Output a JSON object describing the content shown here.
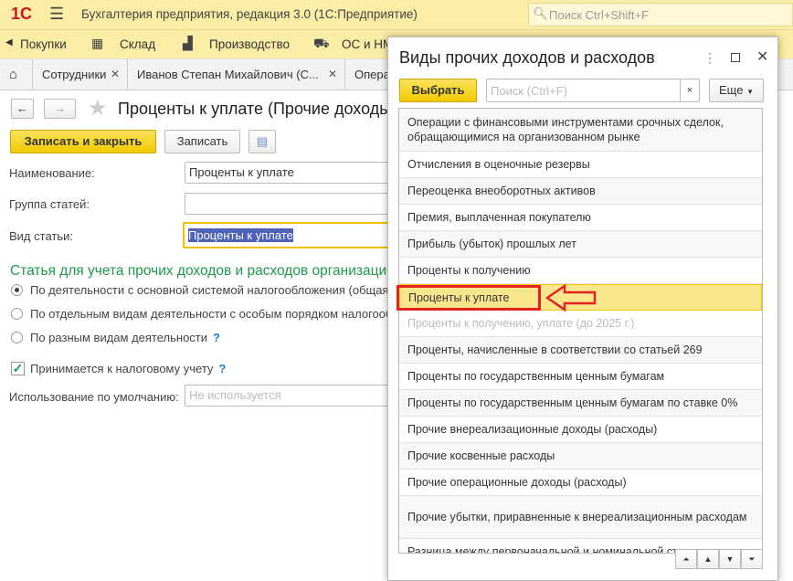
{
  "app": {
    "title": "Бухгалтерия предприятия, редакция 3.0  (1С:Предприятие)",
    "search_placeholder": "Поиск Ctrl+Shift+F"
  },
  "sections": [
    "Покупки",
    "Склад",
    "Производство",
    "ОС и НМА"
  ],
  "tabs": [
    "Сотрудники",
    "Иванов Степан Михайлович (С...",
    "Опера"
  ],
  "form": {
    "title": "Проценты к уплате (Прочие доходы и расходы)",
    "save_close": "Записать и закрыть",
    "save": "Записать",
    "name_label": "Наименование:",
    "name_value": "Проценты к уплате",
    "group_label": "Группа статей:",
    "group_value": "",
    "kind_label": "Вид статьи:",
    "kind_value": "Проценты к уплате",
    "section_title": "Статья для учета прочих доходов и расходов организации",
    "radios": [
      "По деятельности с основной системой налогообложения (общая)",
      "По отдельным видам деятельности с особым порядком налогообложения",
      "По разным видам деятельности"
    ],
    "radio_help": "?",
    "tax_checkbox": "Принимается к налоговому учету",
    "tax_checked": true,
    "usage_label": "Использование по умолчанию:",
    "usage_placeholder": "Не используется"
  },
  "dialog": {
    "title": "Виды прочих доходов и расходов",
    "select": "Выбрать",
    "search_placeholder": "Поиск (Ctrl+F)",
    "clear": "×",
    "more": "Еще",
    "items": [
      "Операции с финансовыми инструментами срочных сделок, обращающимися на организованном рынке",
      "Отчисления в оценочные резервы",
      "Переоценка внеоборотных активов",
      "Премия, выплаченная покупателю",
      "Прибыль (убыток) прошлых лет",
      "Проценты к получению",
      "Проценты к уплате",
      "Проценты к получению, уплате (до 2025 г.)",
      "Проценты, начисленные в соответствии со статьей 269",
      "Проценты по государственным ценным бумагам",
      "Проценты по государственным ценным бумагам по ставке 0%",
      "Прочие внереализационные доходы (расходы)",
      "Прочие косвенные расходы",
      "Прочие операционные доходы (расходы)",
      "Прочие убытки, приравненные к внереализационным расходам",
      "Разница между первоначальной и номинальной стоимостью"
    ],
    "selected_index": 6,
    "disabled_index": 7
  }
}
